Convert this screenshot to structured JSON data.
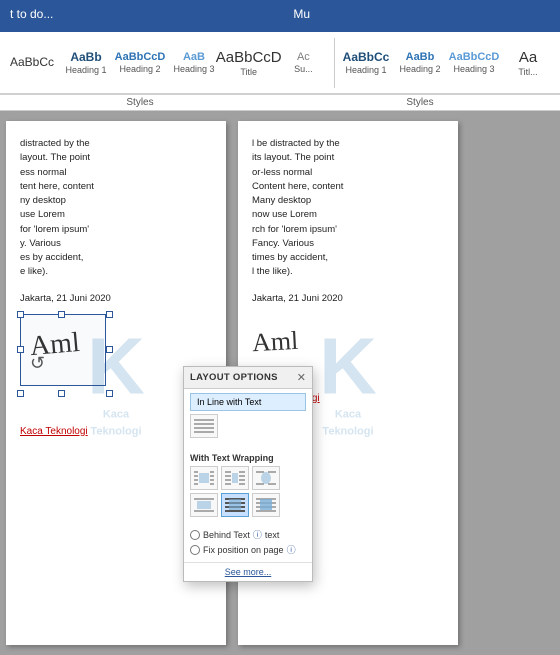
{
  "titlebar": {
    "left": "t to do...",
    "center": "Mu"
  },
  "ribbon": {
    "styles_label": "Styles",
    "styles_label2": "Styles",
    "items": [
      {
        "id": "normal",
        "preview": "AaBbCc",
        "label": ""
      },
      {
        "id": "heading1_left",
        "preview": "AaBb",
        "label": "Heading 1"
      },
      {
        "id": "heading2_left",
        "preview": "AaBbCcD",
        "label": "Heading 2"
      },
      {
        "id": "heading3_left",
        "preview": "AaB",
        "label": "Heading 3"
      },
      {
        "id": "title_left",
        "preview": "AaBbCcD",
        "label": "Title"
      },
      {
        "id": "subtitle_left",
        "preview": "Ac",
        "label": "Su..."
      },
      {
        "id": "heading1_right",
        "preview": "AaBbCc",
        "label": "Heading 1"
      },
      {
        "id": "heading2_right",
        "preview": "AaBb",
        "label": "Heading 2"
      },
      {
        "id": "heading3_right",
        "preview": "AaBbCcD",
        "label": "Heading 3"
      },
      {
        "id": "title_right",
        "preview": "Aa",
        "label": "Titl..."
      }
    ]
  },
  "doc": {
    "page1": {
      "content": "distracted by the\nlayout. The point\nless normal\ntent here, content\nny desktop\nuse Lorem\nfor 'lorem ipsum'\ny. Various\nes by accident,\ne like).",
      "date": "Jakarta, 21 Juni 2020",
      "sig_name": "Kaca Teknologi"
    },
    "page2": {
      "content": "l be distracted by the\nits layout. The point\nor-less normal\nContent here, content\nMany desktop\nnow use Lorem\nrch for 'lorem ipsum'\nFancy. Various\ntimes by accident,\nl the like).",
      "date": "Jakarta, 21 Juni 2020",
      "sig_name": "Kaca Teknologi"
    }
  },
  "popup": {
    "title": "LAYOUT OPTIONS",
    "close": "✕",
    "inline_label": "In Line with Text",
    "with_wrapping_label": "With Text Wrapping",
    "behind_text_label": "Behind Text",
    "fix_position_label": "Fix position on page",
    "see_more": "See more..."
  }
}
